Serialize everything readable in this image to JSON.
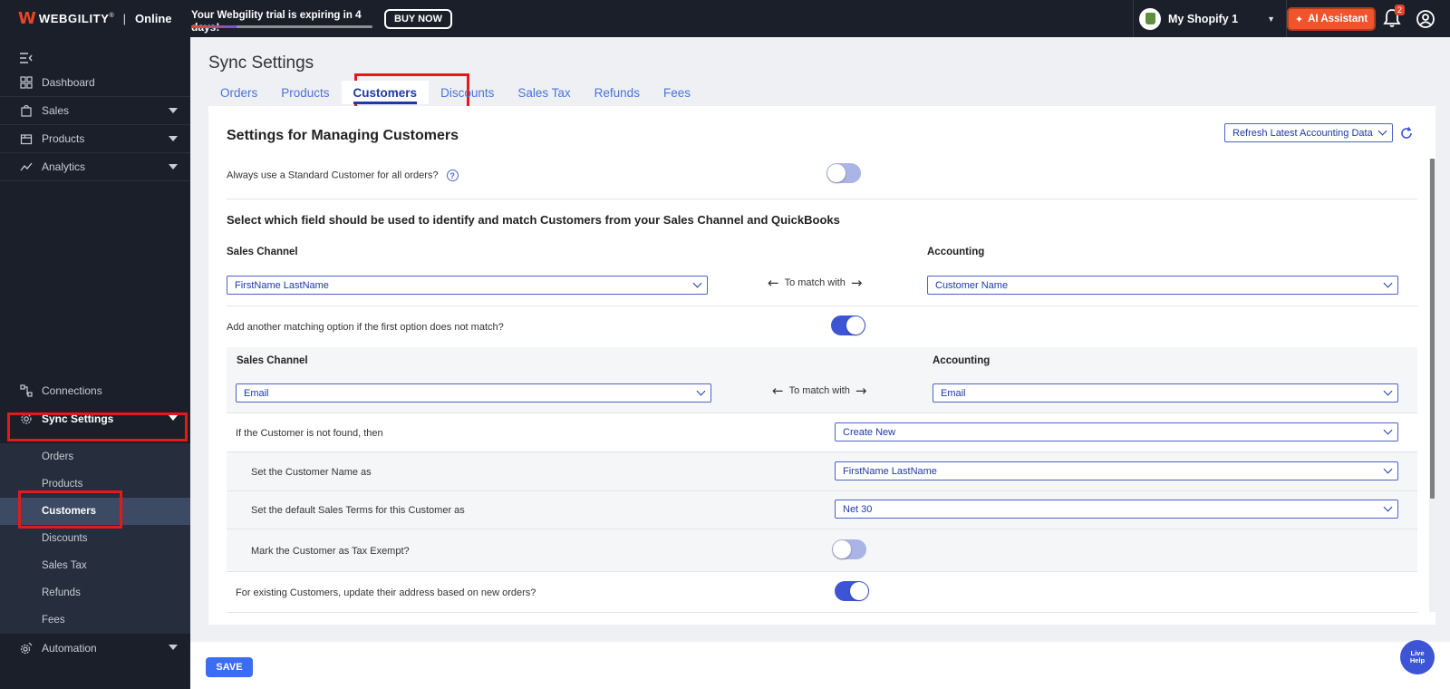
{
  "topbar": {
    "brand": "WEBGILITY",
    "brand_reg": "®",
    "separator": "|",
    "edition": "Online",
    "trial_prefix": "Your Webgility trial is expiring in ",
    "trial_days": "4 days!",
    "trial_progress": 0.25,
    "buy_now": "BUY NOW",
    "store_name": "My Shopify 1",
    "ai_assistant": "AI Assistant",
    "notification_count": "2"
  },
  "sidebar": {
    "items": [
      {
        "label": "Dashboard"
      },
      {
        "label": "Sales"
      },
      {
        "label": "Products"
      },
      {
        "label": "Analytics"
      },
      {
        "label": "Connections"
      },
      {
        "label": "Sync Settings"
      },
      {
        "label": "Automation"
      }
    ],
    "sub_items": [
      {
        "label": "Orders"
      },
      {
        "label": "Products"
      },
      {
        "label": "Customers"
      },
      {
        "label": "Discounts"
      },
      {
        "label": "Sales Tax"
      },
      {
        "label": "Refunds"
      },
      {
        "label": "Fees"
      }
    ]
  },
  "main": {
    "title": "Sync Settings",
    "tabs": [
      {
        "label": "Orders"
      },
      {
        "label": "Products"
      },
      {
        "label": "Customers"
      },
      {
        "label": "Discounts"
      },
      {
        "label": "Sales Tax"
      },
      {
        "label": "Refunds"
      },
      {
        "label": "Fees"
      }
    ],
    "section_title": "Settings for Managing Customers",
    "refresh_select": "Refresh Latest Accounting Data",
    "standard_customer": {
      "label": "Always use a Standard Customer for all orders?",
      "help": "?",
      "enabled": false
    },
    "match_title": "Select which field should be used to identify and match Customers from your Sales Channel and QuickBooks",
    "sales_channel_label": "Sales Channel",
    "accounting_label": "Accounting",
    "match_with": "To match with",
    "primary_sales_field": "FirstName LastName",
    "primary_accounting_field": "Customer Name",
    "another_option": {
      "label": "Add another matching option if the first option does not match?",
      "enabled": true
    },
    "secondary_sales_field": "Email",
    "secondary_accounting_field": "Email",
    "not_found": {
      "label": "If the Customer is not found, then",
      "value": "Create New"
    },
    "customer_name": {
      "label": "Set the Customer Name as",
      "value": "FirstName LastName"
    },
    "sales_terms": {
      "label": "Set the default Sales Terms for this Customer as",
      "value": "Net 30"
    },
    "tax_exempt": {
      "label": "Mark the Customer as Tax Exempt?",
      "enabled": false
    },
    "update_address": {
      "label": "For existing Customers, update their address based on new orders?",
      "enabled": true
    }
  },
  "footer": {
    "save": "SAVE",
    "live_help_line1": "Live",
    "live_help_line2": "Help"
  },
  "colors": {
    "accent": "#3d55d4",
    "brand_orange": "#f0542b",
    "sidebar_bg": "#1b1f2a",
    "highlight_red": "#e21a1a"
  }
}
